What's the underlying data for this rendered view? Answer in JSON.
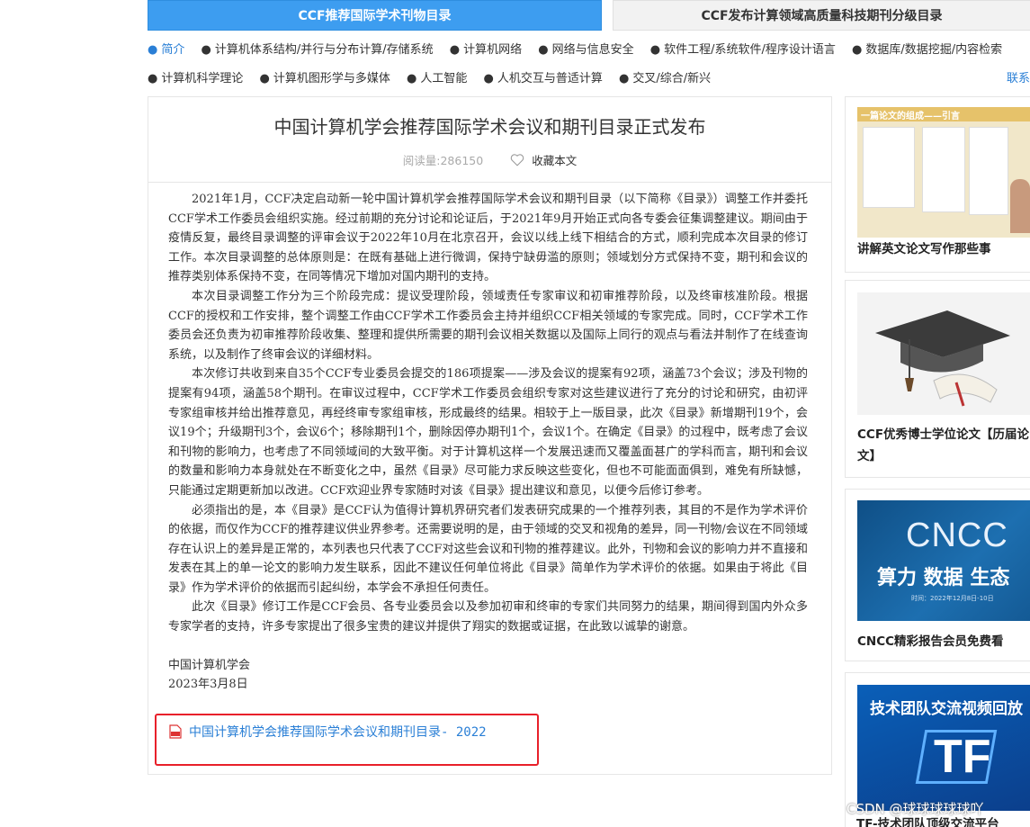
{
  "tabs": {
    "active": "CCF推荐国际学术刊物目录",
    "inactive": "CCF发布计算领域高质量科技期刊分级目录"
  },
  "categories_row1": [
    {
      "label": "简介",
      "active": true
    },
    {
      "label": "计算机体系结构/并行与分布计算/存储系统"
    },
    {
      "label": "计算机网络"
    },
    {
      "label": "网络与信息安全"
    },
    {
      "label": "软件工程/系统软件/程序设计语言"
    },
    {
      "label": "数据库/数据挖掘/内容检索"
    }
  ],
  "categories_row2": [
    {
      "label": "计算机科学理论"
    },
    {
      "label": "计算机图形学与多媒体"
    },
    {
      "label": "人工智能"
    },
    {
      "label": "人机交互与普适计算"
    },
    {
      "label": "交叉/综合/新兴"
    }
  ],
  "contact_link": "联系",
  "article": {
    "title": "中国计算机学会推荐国际学术会议和期刊目录正式发布",
    "reads": "阅读量:286150",
    "favorite": "收藏本文",
    "paragraphs": [
      "2021年1月，CCF决定启动新一轮中国计算机学会推荐国际学术会议和期刊目录（以下简称《目录》）调整工作并委托CCF学术工作委员会组织实施。经过前期的充分讨论和论证后，于2021年9月开始正式向各专委会征集调整建议。期间由于疫情反复，最终目录调整的评审会议于2022年10月在北京召开，会议以线上线下相结合的方式，顺利完成本次目录的修订工作。本次目录调整的总体原则是：在既有基础上进行微调，保持宁缺毋滥的原则；领域划分方式保持不变，期刊和会议的推荐类别体系保持不变，在同等情况下增加对国内期刊的支持。",
      "本次目录调整工作分为三个阶段完成：提议受理阶段，领域责任专家审议和初审推荐阶段，以及终审核准阶段。根据CCF的授权和工作安排，整个调整工作由CCF学术工作委员会主持并组织CCF相关领域的专家完成。同时，CCF学术工作委员会还负责为初审推荐阶段收集、整理和提供所需要的期刊会议相关数据以及国际上同行的观点与看法并制作了在线查询系统，以及制作了终审会议的详细材料。",
      "本次修订共收到来自35个CCF专业委员会提交的186项提案——涉及会议的提案有92项，涵盖73个会议；涉及刊物的提案有94项，涵盖58个期刊。在审议过程中，CCF学术工作委员会组织专家对这些建议进行了充分的讨论和研究，由初评专家组审核并给出推荐意见，再经终审专家组审核，形成最终的结果。相较于上一版目录，此次《目录》新增期刊19个，会议19个；升级期刊3个，会议6个；移除期刊1个，删除因停办期刊1个，会议1个。在确定《目录》的过程中，既考虑了会议和刊物的影响力，也考虑了不同领域间的大致平衡。对于计算机这样一个发展迅速而又覆盖面甚广的学科而言，期刊和会议的数量和影响力本身就处在不断变化之中，虽然《目录》尽可能力求反映这些变化，但也不可能面面俱到，难免有所缺憾，只能通过定期更新加以改进。CCF欢迎业界专家随时对该《目录》提出建议和意见，以便今后修订参考。",
      "必须指出的是，本《目录》是CCF认为值得计算机界研究者们发表研究成果的一个推荐列表，其目的不是作为学术评价的依据，而仅作为CCF的推荐建议供业界参考。还需要说明的是，由于领域的交叉和视角的差异，同一刊物/会议在不同领域存在认识上的差异是正常的，本列表也只代表了CCF对这些会议和刊物的推荐建议。此外，刊物和会议的影响力并不直接和发表在其上的单一论文的影响力发生联系，因此不建议任何单位将此《目录》简单作为学术评价的依据。如果由于将此《目录》作为学术评价的依据而引起纠纷，本学会不承担任何责任。",
      "此次《目录》修订工作是CCF会员、各专业委员会以及参加初审和终审的专家们共同努力的结果，期间得到国内外众多专家学者的支持，许多专家提出了很多宝贵的建议并提供了翔实的数据或证据，在此致以诚挚的谢意。"
    ],
    "org": "中国计算机学会",
    "date": "2023年3月8日",
    "attachment": "中国计算机学会推荐国际学术会议和期刊目录- 2022"
  },
  "sidebar": {
    "items": [
      {
        "title": "讲解英文论文写作那些事",
        "thumb_caption": "一篇论文的组成——引言"
      },
      {
        "title": "CCF优秀博士学位论文【历届论文】"
      },
      {
        "title": "CNCC精彩报告会员免费看",
        "thumb_text": "CNCC",
        "thumb_sub": "算力 数据 生态",
        "thumb_time": "时间：2022年12月8日-10日"
      },
      {
        "thumb_text": "技术团队交流视频回放",
        "thumb_logo": "TF",
        "title": "TF-技术团队顶级交流平台"
      }
    ]
  },
  "watermark": "CSDN @球球球球球吖",
  "colors": {
    "accent": "#3d9df0",
    "link": "#2a7fd6",
    "highlight_box": "#e8202a"
  }
}
